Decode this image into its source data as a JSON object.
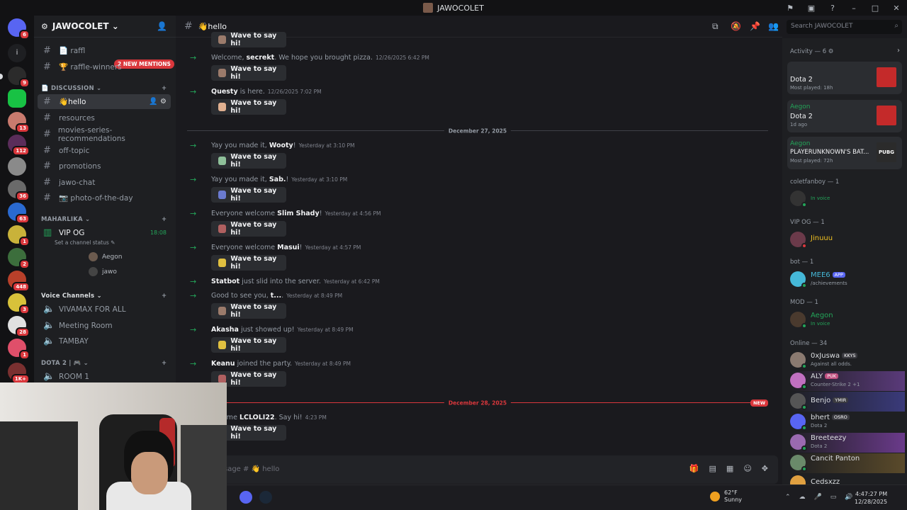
{
  "window": {
    "title": "JAWOCOLET"
  },
  "server": {
    "name": "JAWOCOLET"
  },
  "rail": {
    "badges": [
      "6",
      "9",
      "13",
      "112",
      "36",
      "63",
      "1",
      "2",
      "448",
      "3",
      "28",
      "1",
      "1K+"
    ]
  },
  "sidebar": {
    "mentions_pill": "2 NEW MENTIONS",
    "top_channels": [
      {
        "name": "📄 raffl"
      },
      {
        "name": "🏆 raffle-winners"
      }
    ],
    "category_discussion": "📄 DISCUSSION",
    "discussion_channels": [
      {
        "name": "👋hello",
        "active": true
      },
      {
        "name": "resources"
      },
      {
        "name": "movies-series-recommendations"
      },
      {
        "name": "off-topic"
      },
      {
        "name": "promotions"
      },
      {
        "name": "jawo-chat"
      },
      {
        "name": "📷 photo-of-the-day"
      }
    ],
    "category_maharlika": "MAHARLIKA",
    "vip_channel": {
      "name": "VIP OG",
      "time": "18:08",
      "status": "Set a channel status"
    },
    "voice_users": [
      "Aegon",
      "jawo"
    ],
    "category_voice": "Voice Channels",
    "voice_channels": [
      "VIVAMAX FOR ALL",
      "Meeting Room",
      "TAMBAY"
    ],
    "category_dota": "DOTA 2 | 🎮",
    "dota_rooms": [
      "ROOM 1"
    ]
  },
  "channel": {
    "name": "👋hello",
    "search_placeholder": "Search JAWOCOLET"
  },
  "messages": [
    {
      "pre": "Welcome, ",
      "user": "secrekt",
      "post": ". We hope you brought pizza.",
      "time": "12/26/2025 6:42 PM"
    },
    {
      "pre": "",
      "user": "Questy",
      "post": " is here.",
      "time": "12/26/2025 7:02 PM"
    },
    {
      "pre": "Yay you made it, ",
      "user": "Wooty",
      "post": "!",
      "time": "Yesterday at 3:10 PM"
    },
    {
      "pre": "Yay you made it, ",
      "user": "Sab.",
      "post": "!",
      "time": "Yesterday at 3:10 PM"
    },
    {
      "pre": "Everyone welcome ",
      "user": "Slim Shady",
      "post": "!",
      "time": "Yesterday at 4:56 PM"
    },
    {
      "pre": "Everyone welcome ",
      "user": "Masui",
      "post": "!",
      "time": "Yesterday at 4:57 PM"
    },
    {
      "pre": "",
      "user": "Statbot",
      "post": " just slid into the server.",
      "time": "Yesterday at 6:42 PM"
    },
    {
      "pre": "Good to see you, ",
      "user": "t...",
      "post": ".",
      "time": "Yesterday at 8:49 PM"
    },
    {
      "pre": "",
      "user": "Akasha",
      "post": " just showed up!",
      "time": "Yesterday at 8:49 PM"
    },
    {
      "pre": "",
      "user": "Keanu",
      "post": " joined the party.",
      "time": "Yesterday at 8:49 PM"
    },
    {
      "pre": "ome ",
      "user": "LCLOLI22",
      "post": ". Say hi!",
      "time": "4:23 PM"
    }
  ],
  "wave_label": "Wave to say hi!",
  "dividers": {
    "dec27": "December 27, 2025",
    "dec28": "December 28, 2025",
    "new": "NEW"
  },
  "composer": {
    "placeholder": "sage # 👋 hello"
  },
  "activity": {
    "header": "Activity — 6",
    "cards": [
      {
        "name": "",
        "game": "Dota 2",
        "sub": "Most played: 18h"
      },
      {
        "name": "Aegon",
        "game": "Dota 2",
        "sub": "1d ago"
      },
      {
        "name": "Aegon",
        "game": "PLAYERUNKNOWN'S BAT...",
        "sub": "Most played: 72h",
        "art": "PUBG"
      }
    ]
  },
  "members": {
    "coletfanboy_header": "coletfanboy — 1",
    "coletfanboy_sub": "In voice",
    "vip_header": "VIP OG — 1",
    "vip_name": "Jinuuu",
    "bot_header": "bot — 1",
    "bot_name": "MEE6",
    "bot_tag": "APP",
    "bot_sub": "/achievements",
    "mod_header": "MOD — 1",
    "mod_name": "Aegon",
    "mod_sub": "In voice",
    "online_header": "Online — 34",
    "online": [
      {
        "name": "0xJuswa",
        "tag": "KKYS",
        "sub": "Against all odds."
      },
      {
        "name": "ALY",
        "tag": "PUK",
        "sub": "Counter-Strike 2 +1"
      },
      {
        "name": "Benjo",
        "tag": "YMIR",
        "sub": ""
      },
      {
        "name": "bhert",
        "tag": "OSRO",
        "sub": "Dota 2"
      },
      {
        "name": "Breeteezy",
        "tag": "",
        "sub": "Dota 2"
      },
      {
        "name": "Cancit Panton",
        "tag": "",
        "sub": ""
      },
      {
        "name": "Cedsxzz",
        "tag": "",
        "sub": ""
      }
    ]
  },
  "taskbar": {
    "temp": "62°F",
    "weather": "Sunny",
    "time": "4:47:27 PM",
    "date": "12/28/2025"
  },
  "colors": {
    "accent": "#5865f2",
    "online": "#23a559",
    "danger": "#da373c"
  }
}
